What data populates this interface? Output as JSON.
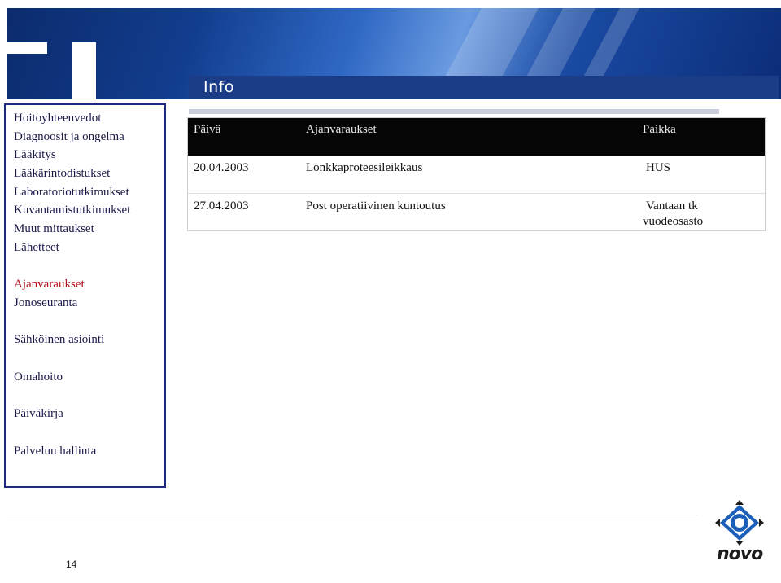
{
  "header": {
    "title": "Info"
  },
  "sidebar": {
    "items": [
      {
        "label": "Hoitoyhteenvedot"
      },
      {
        "label": "Diagnoosit ja ongelma"
      },
      {
        "label": "Lääkitys"
      },
      {
        "label": "Lääkärintodistukset"
      },
      {
        "label": "Laboratoriotutkimukset"
      },
      {
        "label": "Kuvantamistutkimukset"
      },
      {
        "label": "Muut mittaukset"
      },
      {
        "label": "Lähetteet"
      },
      {
        "label": "Ajanvaraukset",
        "active": true
      },
      {
        "label": "Jonoseuranta"
      },
      {
        "label": "Sähköinen asiointi"
      },
      {
        "label": "Omahoito"
      },
      {
        "label": "Päiväkirja"
      },
      {
        "label": "Palvelun hallinta"
      }
    ],
    "active_color": "#b0111b"
  },
  "table": {
    "columns": [
      "Päivä",
      "Ajanvaraukset",
      "Paikka"
    ],
    "rows": [
      {
        "date": "20.04.2003",
        "appointment": "Lonkkaproteesileikkaus",
        "place": "HUS",
        "place_line2": ""
      },
      {
        "date": "27.04.2003",
        "appointment": "Post operatiivinen kuntoutus",
        "place": "Vantaan tk",
        "place_line2": "vuodeosasto"
      }
    ]
  },
  "footer": {
    "page_number": "14",
    "logo_text": "novo"
  },
  "colors": {
    "banner": "#123d8e",
    "title_bar": "#1b3c86",
    "table_header": "#050505",
    "sidebar_border": "#1c2b7c"
  }
}
